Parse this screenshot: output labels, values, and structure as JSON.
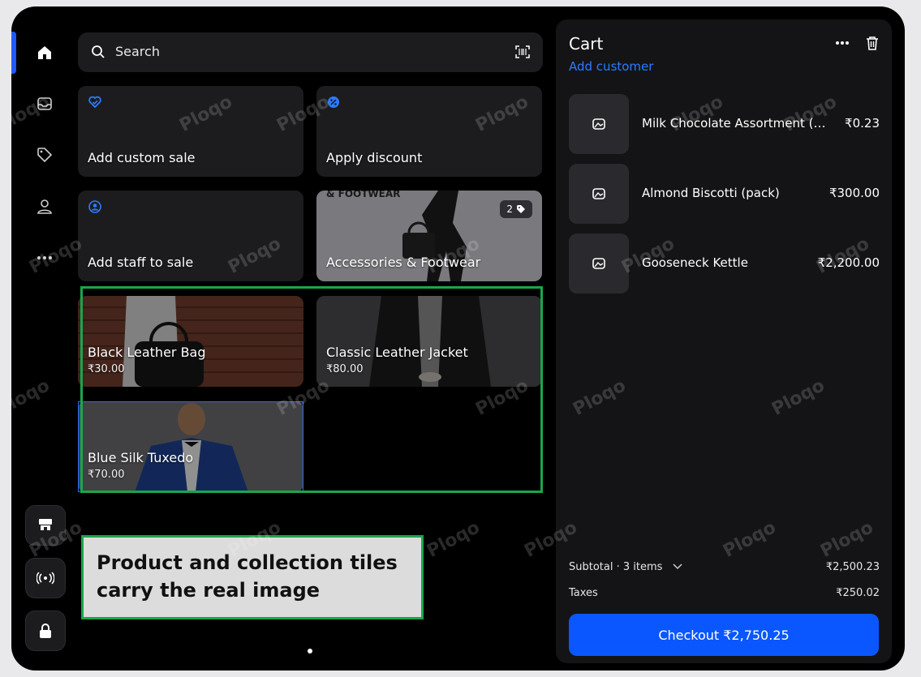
{
  "search": {
    "placeholder": "Search"
  },
  "tiles": {
    "custom_sale": "Add custom sale",
    "apply_discount": "Apply discount",
    "add_staff": "Add staff to sale",
    "accessories": {
      "label": "Accessories & Footwear",
      "count": "2",
      "image_text": "& FOOTWEAR"
    }
  },
  "products": [
    {
      "name": "Black Leather Bag",
      "price": "₹30.00"
    },
    {
      "name": "Classic Leather Jacket",
      "price": "₹80.00"
    },
    {
      "name": "Blue Silk Tuxedo",
      "price": "₹70.00"
    }
  ],
  "callout": {
    "line1": "Product and collection tiles",
    "line2": "carry the real image"
  },
  "cart": {
    "title": "Cart",
    "add_customer": "Add customer",
    "items": [
      {
        "name": "Milk Chocolate Assortment (b…",
        "price": "₹0.23"
      },
      {
        "name": "Almond Biscotti (pack)",
        "price": "₹300.00"
      },
      {
        "name": "Gooseneck Kettle",
        "price": "₹2,200.00"
      }
    ],
    "subtotal_label": "Subtotal · 3 items",
    "subtotal_value": "₹2,500.23",
    "taxes_label": "Taxes",
    "taxes_value": "₹250.02",
    "checkout_label": "Checkout ₹2,750.25"
  },
  "watermark": "Ploqo",
  "colors": {
    "accent": "#0a57ff",
    "link": "#2b7bff",
    "highlight": "#1aa64a"
  }
}
